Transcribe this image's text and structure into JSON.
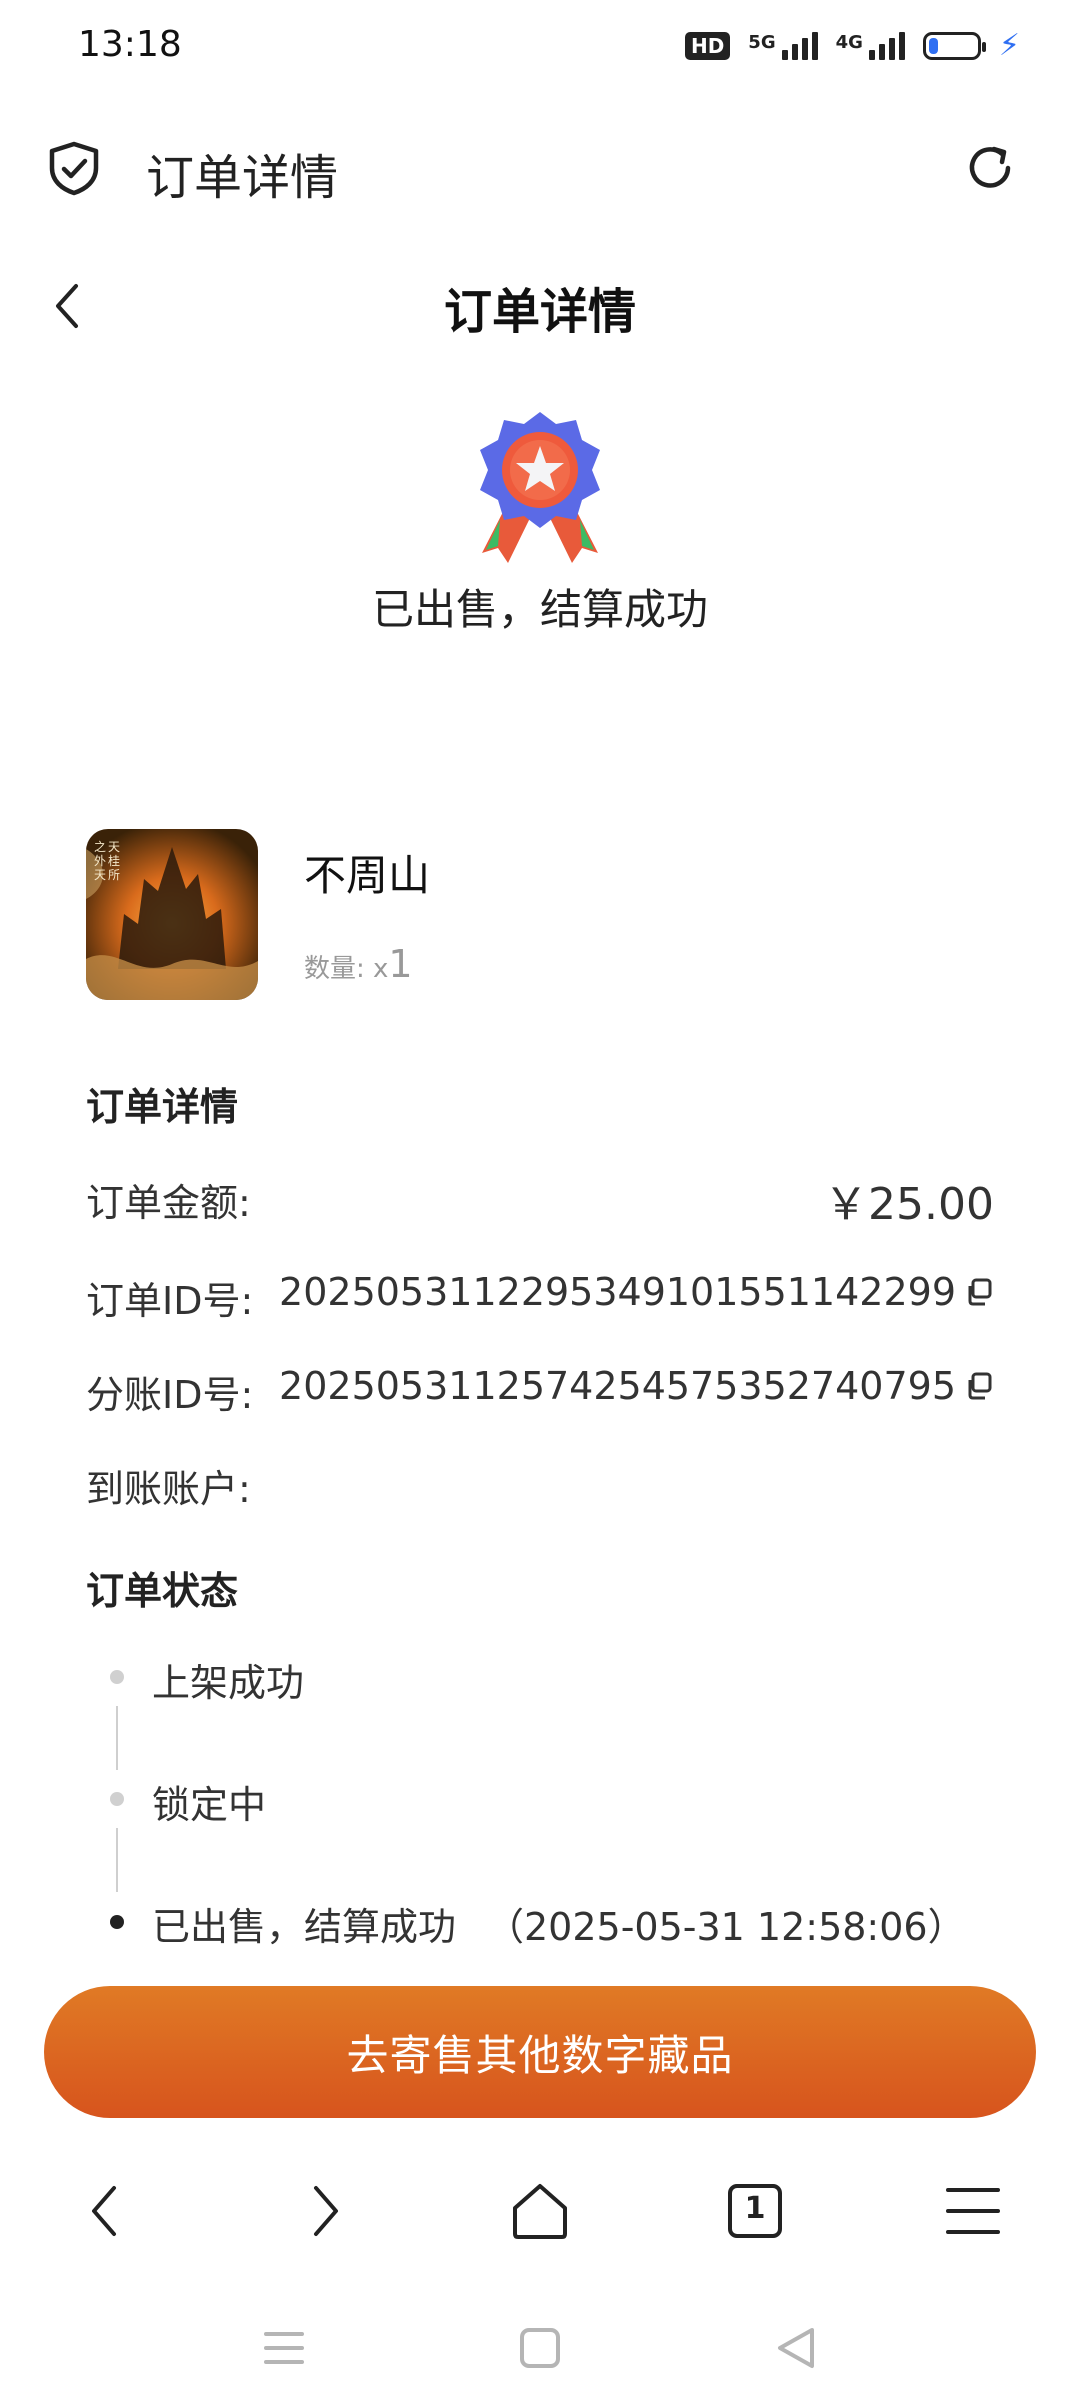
{
  "status_bar": {
    "time": "13:18",
    "hd_badge": "HD",
    "net1": "5G",
    "net2": "4G",
    "battery_level": 0.2,
    "charging_icon": "bolt-icon"
  },
  "browser": {
    "title": "订单详情",
    "left_icon": "shield-check-icon",
    "right_icon": "refresh-icon"
  },
  "page": {
    "back_icon": "chevron-left-icon",
    "title": "订单详情",
    "status_icon": "medal-star-icon",
    "status_text": "已出售，结算成功"
  },
  "product": {
    "name": "不周山",
    "qty_label": "数量:",
    "qty_prefix": "x",
    "qty_value": "1"
  },
  "details": {
    "section_title": "订单详情",
    "amount_label": "订单金额:",
    "amount_value": "￥25.00",
    "order_id_label": "订单ID号:",
    "order_id_value": "2025053112295349101551142299",
    "split_id_label": "分账ID号:",
    "split_id_value": "2025053112574254575352740795",
    "account_label": "到账账户:",
    "account_value": ""
  },
  "order_status": {
    "section_title": "订单状态",
    "steps": [
      {
        "label": "上架成功",
        "time": ""
      },
      {
        "label": "锁定中",
        "time": ""
      },
      {
        "label": "已出售，结算成功",
        "time": "（2025-05-31 12:58:06）"
      }
    ]
  },
  "cta": {
    "label": "去寄售其他数字藏品",
    "color_top": "#e07a25",
    "color_bottom": "#d7541d"
  },
  "browser_nav": {
    "tab_count": "1",
    "icons": [
      "back-icon",
      "forward-icon",
      "home-icon",
      "tabs-icon",
      "menu-icon"
    ]
  },
  "system_nav": {
    "icons": [
      "recents-icon",
      "home-square-icon",
      "back-triangle-icon"
    ]
  }
}
